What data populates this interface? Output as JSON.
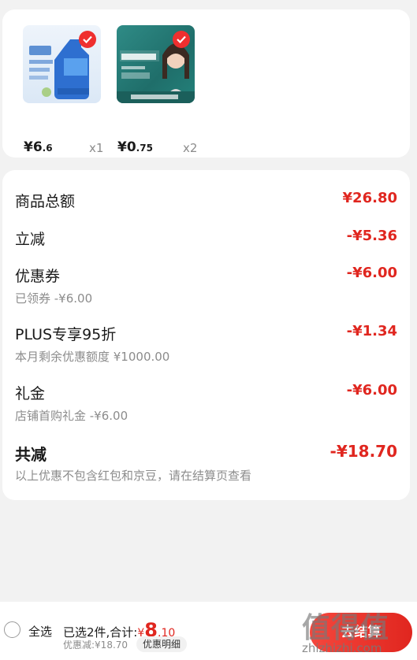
{
  "products": [
    {
      "price_int": "¥6",
      "price_dec": ".6",
      "qty": "x1",
      "image": "detergent-bottle",
      "selected": true
    },
    {
      "price_int": "¥0",
      "price_dec": ".75",
      "qty": "x2",
      "image": "hair-follicle-test",
      "selected": true
    }
  ],
  "breakdown": {
    "goods_total": {
      "label": "商品总额",
      "amount": "¥26.80"
    },
    "instant_discount": {
      "label": "立减",
      "amount": "-¥5.36"
    },
    "coupon": {
      "label": "优惠券",
      "amount": "-¥6.00",
      "sub": "已领券 -¥6.00"
    },
    "plus": {
      "label": "PLUS专享95折",
      "amount": "-¥1.34",
      "sub": "本月剩余优惠额度 ¥1000.00"
    },
    "gift": {
      "label": "礼金",
      "amount": "-¥6.00",
      "sub": "店铺首购礼金 -¥6.00"
    },
    "total": {
      "label": "共减",
      "amount": "-¥18.70",
      "sub": "以上优惠不包含红包和京豆，请在结算页查看"
    }
  },
  "footer": {
    "select_all": "全选",
    "selected_prefix": "已选2件,合计:",
    "total_sym": "¥",
    "total_int": "8",
    "total_dec": ".10",
    "discount_text": "优惠减:¥18.70",
    "detail_button": "优惠明细",
    "checkout_button": "去结算"
  },
  "watermark": {
    "mark": "值得值",
    "url": "zhizhizhi.com"
  },
  "colors": {
    "accent": "#e0261f",
    "muted": "#8c8c8c",
    "background": "#f2f2f2"
  }
}
